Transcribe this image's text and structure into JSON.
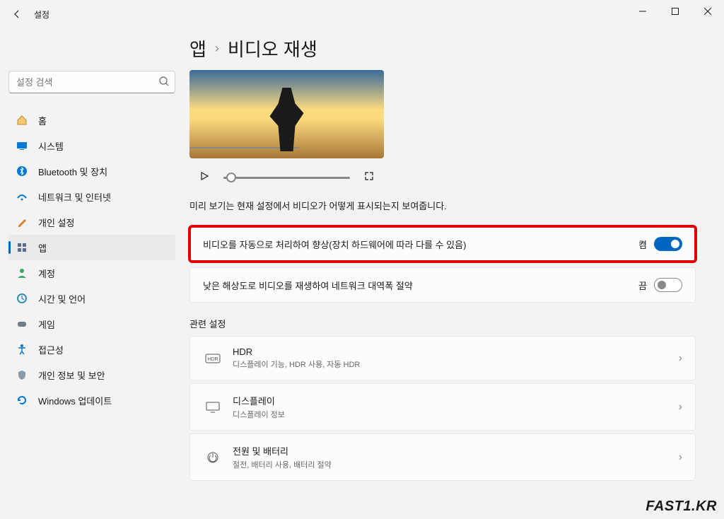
{
  "window": {
    "title": "설정"
  },
  "search": {
    "placeholder": "설정 검색"
  },
  "sidebar": {
    "items": [
      {
        "label": "홈"
      },
      {
        "label": "시스템"
      },
      {
        "label": "Bluetooth 및 장치"
      },
      {
        "label": "네트워크 및 인터넷"
      },
      {
        "label": "개인 설정"
      },
      {
        "label": "앱"
      },
      {
        "label": "계정"
      },
      {
        "label": "시간 및 언어"
      },
      {
        "label": "게임"
      },
      {
        "label": "접근성"
      },
      {
        "label": "개인 정보 및 보안"
      },
      {
        "label": "Windows 업데이트"
      }
    ]
  },
  "breadcrumb": {
    "parent": "앱",
    "sep": "›",
    "current": "비디오 재생"
  },
  "preview_note": "미리 보기는 현재 설정에서 비디오가 어떻게 표시되는지 보여줍니다.",
  "settings": {
    "auto_process": {
      "label": "비디오를 자동으로 처리하여 향상(장치 하드웨어에 따라 다를 수 있음)",
      "state": "켬"
    },
    "low_res": {
      "label": "낮은 해상도로 비디오를 재생하여 네트워크 대역폭 절약",
      "state": "끔"
    }
  },
  "related": {
    "header": "관련 설정",
    "items": [
      {
        "title": "HDR",
        "sub": "디스플레이 기능, HDR 사용, 자동 HDR"
      },
      {
        "title": "디스플레이",
        "sub": "디스플레이 정보"
      },
      {
        "title": "전원 및 배터리",
        "sub": "절전, 배터리 사용, 배터리 절약"
      }
    ]
  },
  "watermark": "FAST1.KR"
}
